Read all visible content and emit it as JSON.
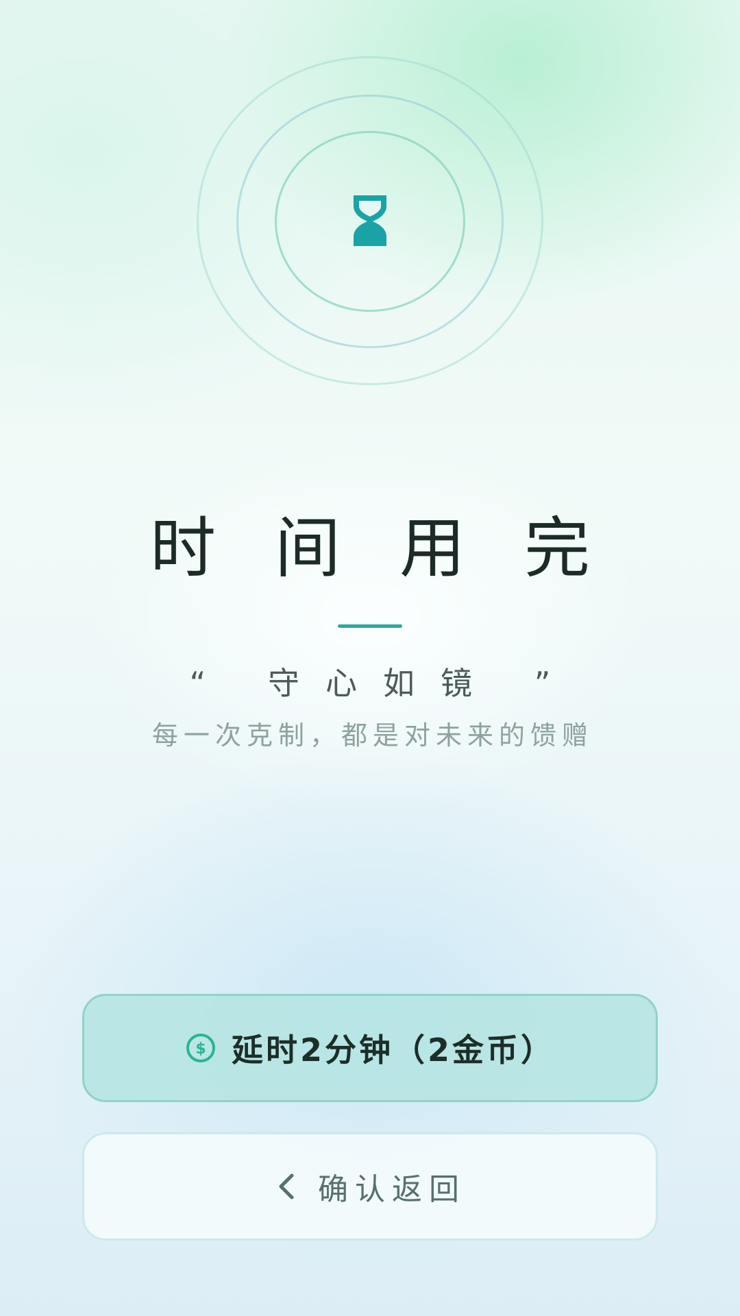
{
  "screen": {
    "title": "时间用完",
    "motto": "“ 守心如镜 ”",
    "subtitle": "每一次克制，都是对未来的馈赠"
  },
  "icons": {
    "main": "hourglass-icon",
    "extend": "coin-icon",
    "back": "chevron-left-icon"
  },
  "actions": {
    "extend_label": "延时2分钟（2金币）",
    "back_label": "确认返回"
  },
  "colors": {
    "accent": "#1aa3a6",
    "coin": "#2bb38f",
    "title_text": "#1c2b26"
  }
}
